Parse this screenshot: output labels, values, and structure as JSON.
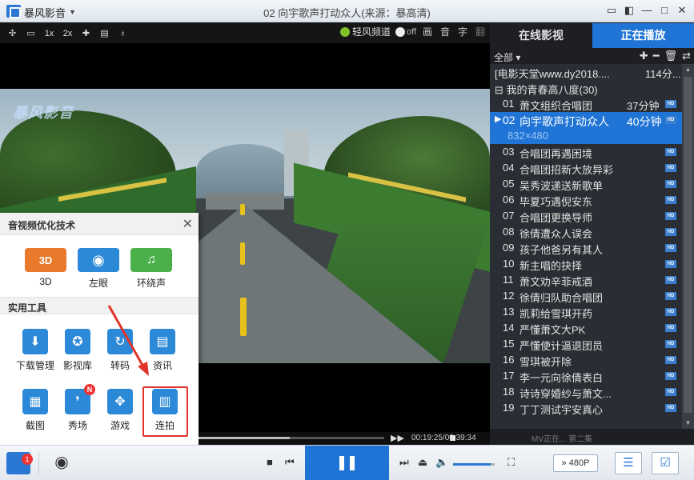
{
  "app": {
    "name": "暴风影音"
  },
  "window": {
    "title": "02 向宇歌声打动众人(来源：暴高清)"
  },
  "toolbar": {
    "speed_1x": "1x",
    "speed_2x": "2x",
    "breeze_label": "轻风频道",
    "toggle_state": "off",
    "picture_label": "画",
    "audio_label": "音",
    "subtitle_label": "字",
    "translate_label": "翻"
  },
  "video": {
    "watermark": "暴风影音"
  },
  "panel": {
    "title": "音视频优化技术",
    "section_tools": "实用工具",
    "effects": [
      {
        "label": "3D",
        "text": "3D"
      },
      {
        "label": "左眼"
      },
      {
        "label": "环绕声"
      }
    ],
    "tools": [
      {
        "label": "下载管理"
      },
      {
        "label": "影视库"
      },
      {
        "label": "转码"
      },
      {
        "label": "资讯"
      },
      {
        "label": "截图"
      },
      {
        "label": "秀场",
        "badge": "N"
      },
      {
        "label": "游戏"
      },
      {
        "label": "连拍"
      }
    ]
  },
  "playback": {
    "current_time": "00:19:25",
    "total_time": "00:39:34",
    "time_display": "00:19:25/00:39:34",
    "progress": 0.49,
    "volume": 0.9,
    "quality_label": "480P"
  },
  "bottombar": {
    "toolbox_badge": "1"
  },
  "sidebar": {
    "tab_online": "在线影视",
    "tab_playing": "正在播放",
    "filter_label": "全部",
    "source_row": {
      "text": "[电影天堂www.dy2018....",
      "duration": "114分..."
    },
    "group_row": {
      "text": "我的青春高八度(30)"
    },
    "selected_resolution": "832×480",
    "hd_badge": "HD",
    "footer": "MV正在...  第二集"
  },
  "playlist": [
    {
      "num": "01",
      "name": "萧文组织合唱团",
      "duration": "37分钟"
    },
    {
      "num": "02",
      "name": "向宇歌声打动众人",
      "duration": "40分钟",
      "selected": true
    },
    {
      "num": "03",
      "name": "合唱团再遇困境",
      "duration": ""
    },
    {
      "num": "04",
      "name": "合唱团招新大放异彩",
      "duration": ""
    },
    {
      "num": "05",
      "name": "吴秀波递送新歌单",
      "duration": ""
    },
    {
      "num": "06",
      "name": "毕夏巧遇倪安东",
      "duration": ""
    },
    {
      "num": "07",
      "name": "合唱团更换导师",
      "duration": ""
    },
    {
      "num": "08",
      "name": "徐倩遭众人误会",
      "duration": ""
    },
    {
      "num": "09",
      "name": "孩子他爸另有其人",
      "duration": ""
    },
    {
      "num": "10",
      "name": "新主唱的抉择",
      "duration": ""
    },
    {
      "num": "11",
      "name": "萧文劝辛菲戒酒",
      "duration": ""
    },
    {
      "num": "12",
      "name": "徐倩归队助合唱团",
      "duration": ""
    },
    {
      "num": "13",
      "name": "凯莉给雪琪开药",
      "duration": ""
    },
    {
      "num": "14",
      "name": "严懂萧文大PK",
      "duration": ""
    },
    {
      "num": "15",
      "name": "严懂使计逼退团员",
      "duration": ""
    },
    {
      "num": "16",
      "name": "雪琪被开除",
      "duration": ""
    },
    {
      "num": "17",
      "name": "李一元向徐倩表白",
      "duration": ""
    },
    {
      "num": "18",
      "name": "诗诗穿婚纱与萧文...",
      "duration": ""
    },
    {
      "num": "19",
      "name": "丁丁测试宇安真心",
      "duration": ""
    }
  ],
  "colors": {
    "accent": "#1f74d6",
    "highlight_box": "#e0342a",
    "badge_red": "#e33333"
  }
}
